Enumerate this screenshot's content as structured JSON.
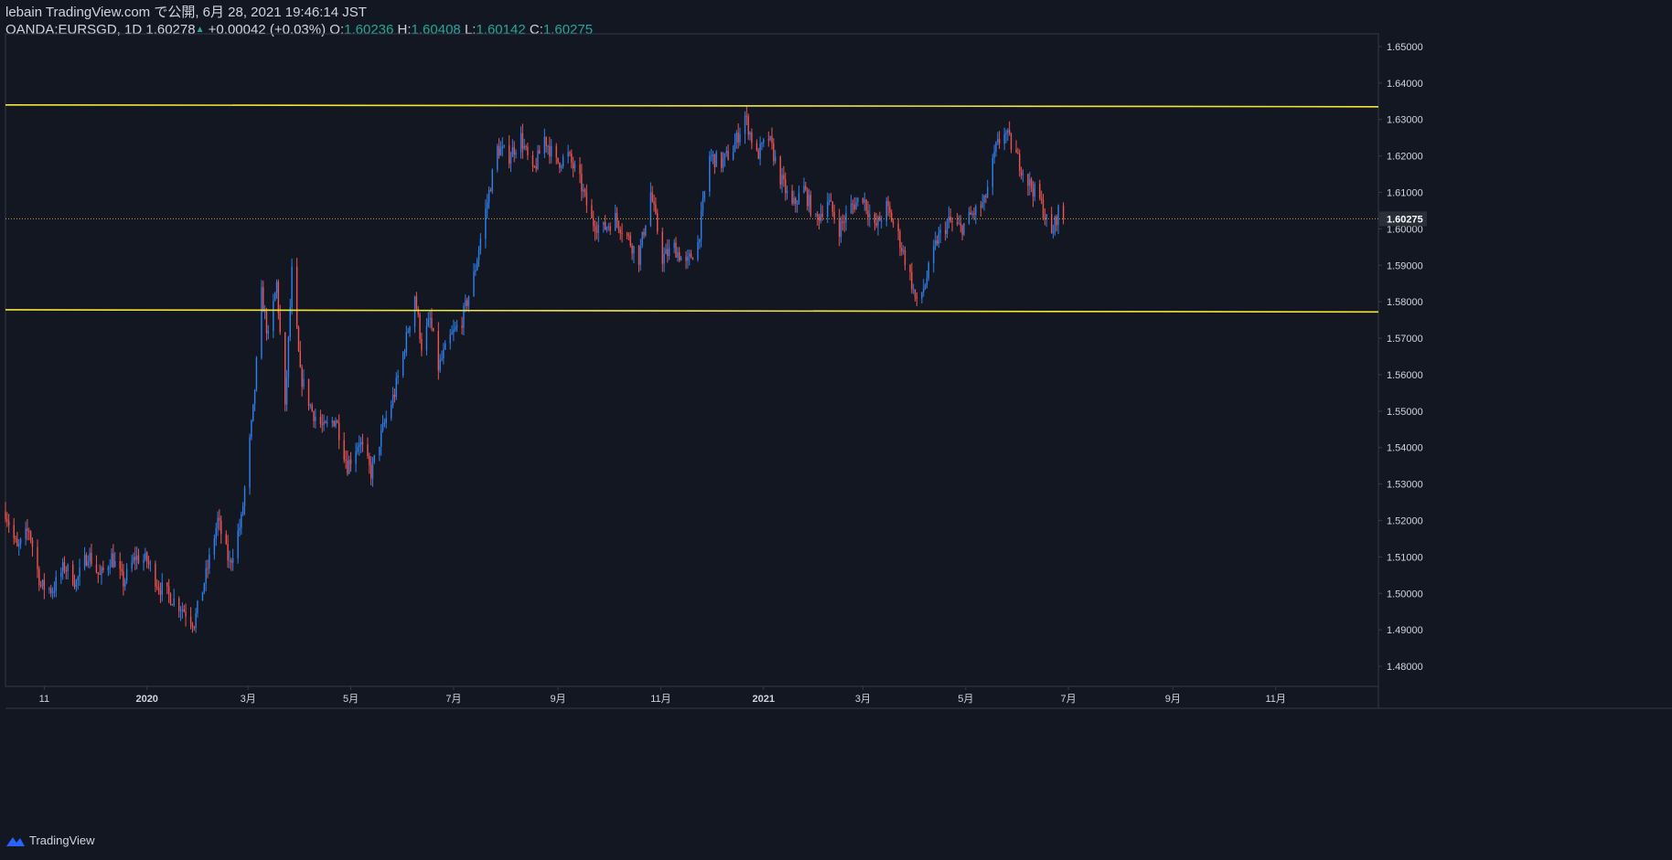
{
  "header": {
    "publish_line": "lebain TradingView.com で公開, 6月 28, 2021 19:46:14 JST",
    "symbol": "OANDA:EURSGD, 1D 1.60278",
    "change_arrow": "▲",
    "change": "+0.00042 (+0.03%)",
    "o_label": "O:",
    "o_value": "1.60236",
    "h_label": "H:",
    "h_value": "1.60408",
    "l_label": "L:",
    "l_value": "1.60142",
    "c_label": "C:",
    "c_value": "1.60275"
  },
  "footer": {
    "brand": "TradingView"
  },
  "colors": {
    "background": "#131722",
    "up": "#2f80ed",
    "down": "#ef5350",
    "support_resistance": "#f5e53b",
    "last_price_line": "#c0a040",
    "grid_text": "#d1d4dc",
    "axis_line": "#363a45"
  },
  "chart_data": {
    "type": "candlestick",
    "symbol": "OANDA:EURSGD",
    "interval": "1D",
    "y_ticks": [
      "1.65000",
      "1.64000",
      "1.63000",
      "1.62000",
      "1.61000",
      "1.60000",
      "1.59000",
      "1.58000",
      "1.57000",
      "1.56000",
      "1.55000",
      "1.54000",
      "1.53000",
      "1.52000",
      "1.51000",
      "1.50000",
      "1.49000",
      "1.48000"
    ],
    "y_tick_values": [
      1.65,
      1.64,
      1.63,
      1.62,
      1.61,
      1.6,
      1.59,
      1.58,
      1.57,
      1.56,
      1.55,
      1.54,
      1.53,
      1.52,
      1.51,
      1.5,
      1.49,
      1.48
    ],
    "ylim": [
      1.4745,
      1.6535
    ],
    "x_ticks": [
      {
        "label": "11",
        "date": "2019-11-01"
      },
      {
        "label": "2020",
        "date": "2020-01-01"
      },
      {
        "label": "3月",
        "date": "2020-03-01"
      },
      {
        "label": "5月",
        "date": "2020-05-01"
      },
      {
        "label": "7月",
        "date": "2020-07-01"
      },
      {
        "label": "9月",
        "date": "2020-09-01"
      },
      {
        "label": "11月",
        "date": "2020-11-01"
      },
      {
        "label": "2021",
        "date": "2021-01-01"
      },
      {
        "label": "3月",
        "date": "2021-03-01"
      },
      {
        "label": "5月",
        "date": "2021-05-01"
      },
      {
        "label": "7月",
        "date": "2021-07-01"
      },
      {
        "label": "9月",
        "date": "2021-09-01"
      },
      {
        "label": "11月",
        "date": "2021-11-01"
      }
    ],
    "xlim": [
      "2019-10-09",
      "2022-01-01"
    ],
    "last_price": "1.60275",
    "last_price_value": 1.60275,
    "horizontal_lines": [
      {
        "start": [
          "2019-10-09",
          1.634
        ],
        "end": [
          "2022-01-01",
          1.6335
        ]
      },
      {
        "start": [
          "2019-10-09",
          1.5778
        ],
        "end": [
          "2022-01-01",
          1.5772
        ]
      }
    ],
    "close_path": [
      [
        "2019-10-09",
        1.5225
      ],
      [
        "2019-10-16",
        1.512
      ],
      [
        "2019-10-23",
        1.5175
      ],
      [
        "2019-10-30",
        1.502
      ],
      [
        "2019-11-06",
        1.501
      ],
      [
        "2019-11-13",
        1.5075
      ],
      [
        "2019-11-20",
        1.503
      ],
      [
        "2019-11-27",
        1.511
      ],
      [
        "2019-12-04",
        1.5045
      ],
      [
        "2019-12-11",
        1.51
      ],
      [
        "2019-12-18",
        1.503
      ],
      [
        "2019-12-25",
        1.51
      ],
      [
        "2020-01-01",
        1.509
      ],
      [
        "2020-01-08",
        1.502
      ],
      [
        "2020-01-15",
        1.499
      ],
      [
        "2020-01-22",
        1.496
      ],
      [
        "2020-01-29",
        1.492
      ],
      [
        "2020-02-05",
        1.505
      ],
      [
        "2020-02-12",
        1.52
      ],
      [
        "2020-02-19",
        1.508
      ],
      [
        "2020-02-26",
        1.52
      ],
      [
        "2020-03-04",
        1.55
      ],
      [
        "2020-03-09",
        1.582
      ],
      [
        "2020-03-13",
        1.57
      ],
      [
        "2020-03-18",
        1.585
      ],
      [
        "2020-03-23",
        1.55
      ],
      [
        "2020-03-27",
        1.588
      ],
      [
        "2020-04-01",
        1.56
      ],
      [
        "2020-04-08",
        1.55
      ],
      [
        "2020-04-15",
        1.545
      ],
      [
        "2020-04-22",
        1.548
      ],
      [
        "2020-04-29",
        1.535
      ],
      [
        "2020-05-06",
        1.542
      ],
      [
        "2020-05-13",
        1.533
      ],
      [
        "2020-05-20",
        1.545
      ],
      [
        "2020-05-27",
        1.555
      ],
      [
        "2020-06-03",
        1.57
      ],
      [
        "2020-06-08",
        1.582
      ],
      [
        "2020-06-12",
        1.568
      ],
      [
        "2020-06-17",
        1.575
      ],
      [
        "2020-06-22",
        1.562
      ],
      [
        "2020-06-29",
        1.57
      ],
      [
        "2020-07-06",
        1.575
      ],
      [
        "2020-07-13",
        1.587
      ],
      [
        "2020-07-20",
        1.605
      ],
      [
        "2020-07-27",
        1.622
      ],
      [
        "2020-08-03",
        1.62
      ],
      [
        "2020-08-10",
        1.625
      ],
      [
        "2020-08-17",
        1.615
      ],
      [
        "2020-08-24",
        1.625
      ],
      [
        "2020-08-31",
        1.618
      ],
      [
        "2020-09-07",
        1.62
      ],
      [
        "2020-09-14",
        1.613
      ],
      [
        "2020-09-21",
        1.602
      ],
      [
        "2020-09-28",
        1.6
      ],
      [
        "2020-10-05",
        1.603
      ],
      [
        "2020-10-12",
        1.598
      ],
      [
        "2020-10-19",
        1.592
      ],
      [
        "2020-10-26",
        1.61
      ],
      [
        "2020-11-02",
        1.592
      ],
      [
        "2020-11-09",
        1.595
      ],
      [
        "2020-11-16",
        1.59
      ],
      [
        "2020-11-23",
        1.596
      ],
      [
        "2020-11-30",
        1.62
      ],
      [
        "2020-12-07",
        1.618
      ],
      [
        "2020-12-14",
        1.622
      ],
      [
        "2020-12-21",
        1.631
      ],
      [
        "2020-12-28",
        1.62
      ],
      [
        "2021-01-04",
        1.625
      ],
      [
        "2021-01-11",
        1.614
      ],
      [
        "2021-01-18",
        1.606
      ],
      [
        "2021-01-25",
        1.611
      ],
      [
        "2021-02-01",
        1.602
      ],
      [
        "2021-02-08",
        1.608
      ],
      [
        "2021-02-15",
        1.6
      ],
      [
        "2021-02-22",
        1.606
      ],
      [
        "2021-03-01",
        1.609
      ],
      [
        "2021-03-08",
        1.6
      ],
      [
        "2021-03-15",
        1.606
      ],
      [
        "2021-03-22",
        1.598
      ],
      [
        "2021-03-29",
        1.587
      ],
      [
        "2021-04-02",
        1.579
      ],
      [
        "2021-04-07",
        1.585
      ],
      [
        "2021-04-14",
        1.597
      ],
      [
        "2021-04-21",
        1.602
      ],
      [
        "2021-04-28",
        1.6
      ],
      [
        "2021-05-05",
        1.604
      ],
      [
        "2021-05-12",
        1.607
      ],
      [
        "2021-05-19",
        1.622
      ],
      [
        "2021-05-24",
        1.627
      ],
      [
        "2021-05-31",
        1.62
      ],
      [
        "2021-06-07",
        1.613
      ],
      [
        "2021-06-14",
        1.608
      ],
      [
        "2021-06-21",
        1.598
      ],
      [
        "2021-06-25",
        1.605
      ],
      [
        "2021-06-28",
        1.60275
      ]
    ]
  }
}
